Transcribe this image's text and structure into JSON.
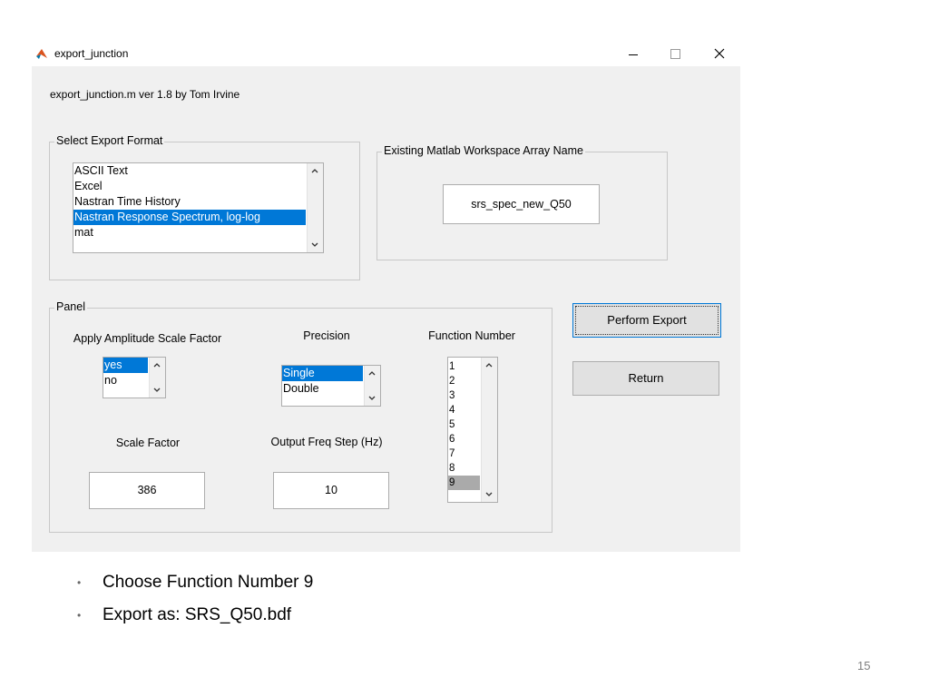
{
  "window": {
    "title": "export_junction",
    "header_text": "export_junction.m  ver 1.8 by Tom Irvine"
  },
  "format_group": {
    "label": "Select Export Format",
    "items": [
      "ASCII Text",
      "Excel",
      "Nastran Time History",
      "Nastran Response Spectrum, log-log",
      "mat"
    ],
    "selected": "Nastran Response Spectrum, log-log"
  },
  "workspace_group": {
    "label": "Existing Matlab Workspace Array Name",
    "value": "srs_spec_new_Q50"
  },
  "panel": {
    "label": "Panel",
    "amp_label": "Apply Amplitude Scale Factor",
    "amp_items": [
      "yes",
      "no"
    ],
    "amp_selected": "yes",
    "precision_label": "Precision",
    "precision_items": [
      "Single",
      "Double"
    ],
    "precision_selected": "Single",
    "function_label": "Function Number",
    "function_items": [
      "1",
      "2",
      "3",
      "4",
      "5",
      "6",
      "7",
      "8",
      "9"
    ],
    "function_selected": "9",
    "scale_label": "Scale Factor",
    "scale_value": "386",
    "freq_label": "Output Freq Step (Hz)",
    "freq_value": "10"
  },
  "buttons": {
    "perform": "Perform Export",
    "return": "Return"
  },
  "slide": {
    "bullets": [
      "Choose Function Number 9",
      "Export as:  SRS_Q50.bdf"
    ],
    "page_number": "15"
  },
  "colors": {
    "selection": "#0078d7",
    "inactive_selection": "#aaaaaa",
    "window_bg": "#f0f0f0"
  },
  "icons": [
    "matlab-icon",
    "minimize-icon",
    "maximize-icon",
    "close-icon",
    "chevron-up-icon",
    "chevron-down-icon",
    "bullet-icon"
  ]
}
